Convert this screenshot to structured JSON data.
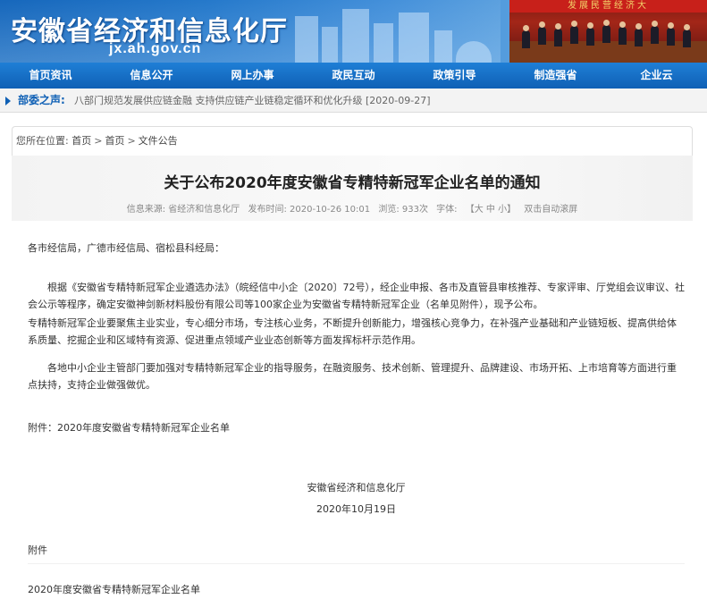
{
  "header": {
    "site_title": "安徽省经济和信息化厅",
    "site_url": "jx.ah.gov.cn",
    "banner_slogan": "发展民营经济大"
  },
  "nav": {
    "items": [
      "首页资讯",
      "信息公开",
      "网上办事",
      "政民互动",
      "政策引导",
      "制造强省",
      "企业云"
    ]
  },
  "notice": {
    "label": "部委之声:",
    "text": "八部门规范发展供应链金融 支持供应链产业链稳定循环和优化升级 [2020-09-27]"
  },
  "breadcrumb": {
    "label": "您所在位置:",
    "items": [
      "首页",
      "首页",
      "文件公告"
    ],
    "sep": ">"
  },
  "article": {
    "title": "关于公布2020年度安徽省专精特新冠军企业名单的通知",
    "meta": {
      "source": "信息来源:  省经济和信息化厅",
      "published": "发布时间:  2020-10-26 10:01",
      "views": "浏览:  933次",
      "font_label": "字体:",
      "font_sizes": "【大 中 小】",
      "autoscroll": "双击自动滚屏"
    },
    "addressee": "各市经信局，广德市经信局、宿松县科经局：",
    "para1": "根据《安徽省专精特新冠军企业遴选办法》（皖经信中小企〔2020〕72号），经企业申报、各市及直管县审核推荐、专家评审、厅党组会议审议、社会公示等程序，确定安徽神剑新材料股份有限公司等100家企业为安徽省专精特新冠军企业（名单见附件），现予公布。",
    "para2": "专精特新冠军企业要聚焦主业实业，专心细分市场，专注核心业务，不断提升创新能力，增强核心竞争力，在补强产业基础和产业链短板、提高供给体系质量、挖掘企业和区域特有资源、促进重点领域产业业态创新等方面发挥标杆示范作用。",
    "para3": "各地中小企业主管部门要加强对专精特新冠军企业的指导服务，在融资服务、技术创新、管理提升、品牌建设、市场开拓、上市培育等方面进行重点扶持，支持企业做强做优。",
    "attachment": "附件：2020年度安徽省专精特新冠军企业名单",
    "org": "安徽省经济和信息化厅",
    "date": "2020年10月19日",
    "attachment_heading": "附件",
    "attachment_title": "2020年度安徽省专精特新冠军企业名单"
  }
}
